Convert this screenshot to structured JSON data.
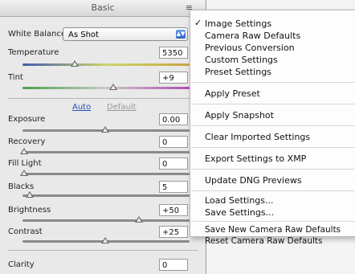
{
  "panel": {
    "title": "Basic",
    "white_balance_label": "White Balance:",
    "white_balance_value": "As Shot",
    "auto_label": "Auto",
    "default_label": "Default",
    "controls": [
      {
        "label": "Temperature",
        "value": "5350"
      },
      {
        "label": "Tint",
        "value": "+9"
      },
      {
        "label": "Exposure",
        "value": "0.00"
      },
      {
        "label": "Recovery",
        "value": "0"
      },
      {
        "label": "Fill Light",
        "value": "0"
      },
      {
        "label": "Blacks",
        "value": "5"
      },
      {
        "label": "Brightness",
        "value": "+50"
      },
      {
        "label": "Contrast",
        "value": "+25"
      },
      {
        "label": "Clarity",
        "value": "0"
      }
    ]
  },
  "menu": {
    "items": [
      "Image Settings",
      "Camera Raw Defaults",
      "Previous Conversion",
      "Custom Settings",
      "Preset Settings",
      "Apply Preset",
      "Apply Snapshot",
      "Clear Imported Settings",
      "Export Settings to XMP",
      "Update DNG Previews",
      "Load Settings...",
      "Save Settings...",
      "Save New Camera Raw Defaults",
      "Reset Camera Raw Defaults"
    ],
    "checked_item": "Image Settings"
  }
}
